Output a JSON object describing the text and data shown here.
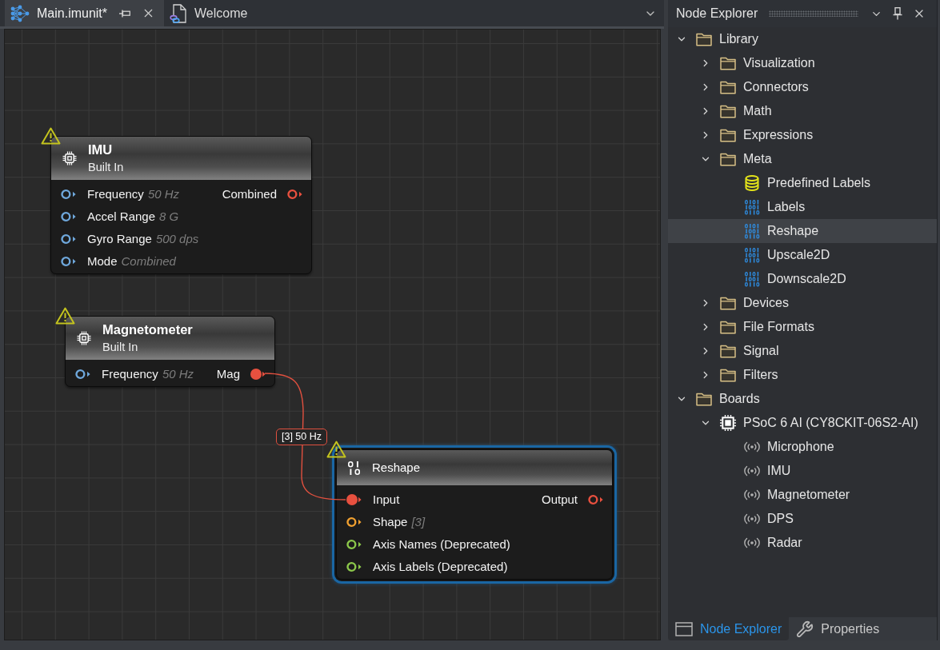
{
  "document_tabs": [
    {
      "label": "Main.imunit*",
      "selected": true
    },
    {
      "label": "Welcome",
      "selected": false
    }
  ],
  "canvas": {
    "nodes": [
      {
        "kind": "device",
        "title": "IMU",
        "subtitle": "Built In",
        "warning": true,
        "selected": false,
        "inputs": [
          {
            "label": "Frequency",
            "value": "50 Hz",
            "color": "#6fa8dc",
            "connected": false
          },
          {
            "label": "Accel Range",
            "value": "8 G",
            "color": "#6fa8dc",
            "connected": false
          },
          {
            "label": "Gyro Range",
            "value": "500 dps",
            "color": "#6fa8dc",
            "connected": false
          },
          {
            "label": "Mode",
            "value": "Combined",
            "color": "#6fa8dc",
            "connected": false
          }
        ],
        "outputs": [
          {
            "label": "Combined",
            "color": "#e8503f",
            "connected": false
          }
        ]
      },
      {
        "kind": "device",
        "title": "Magnetometer",
        "subtitle": "Built In",
        "warning": true,
        "selected": false,
        "inputs": [
          {
            "label": "Frequency",
            "value": "50 Hz",
            "color": "#6fa8dc",
            "connected": false
          }
        ],
        "outputs": [
          {
            "label": "Mag",
            "color": "#e8503f",
            "connected": true
          }
        ]
      },
      {
        "kind": "operation",
        "title": "Reshape",
        "warning": true,
        "selected": true,
        "inputs": [
          {
            "label": "Input",
            "color": "#e8503f",
            "connected": true
          },
          {
            "label": "Shape",
            "value": "[3]",
            "color": "#f0a030",
            "connected": false
          },
          {
            "label": "Axis Names (Deprecated)",
            "color": "#8cc84b",
            "connected": false
          },
          {
            "label": "Axis Labels (Deprecated)",
            "color": "#8cc84b",
            "connected": false
          }
        ],
        "outputs": [
          {
            "label": "Output",
            "color": "#e8503f",
            "connected": false
          }
        ]
      }
    ],
    "connections": [
      {
        "label": "[3] 50 Hz"
      }
    ]
  },
  "panel": {
    "title": "Node Explorer",
    "tree": [
      {
        "label": "Library",
        "kind": "folder",
        "expanded": true,
        "selected": false,
        "children": [
          {
            "label": "Visualization",
            "kind": "folder",
            "expanded": false,
            "selected": false
          },
          {
            "label": "Connectors",
            "kind": "folder",
            "expanded": false,
            "selected": false
          },
          {
            "label": "Math",
            "kind": "folder",
            "expanded": false,
            "selected": false
          },
          {
            "label": "Expressions",
            "kind": "folder",
            "expanded": false,
            "selected": false
          },
          {
            "label": "Meta",
            "kind": "folder",
            "expanded": true,
            "selected": false,
            "children": [
              {
                "label": "Predefined Labels",
                "kind": "database",
                "selected": false
              },
              {
                "label": "Labels",
                "kind": "node",
                "selected": false
              },
              {
                "label": "Reshape",
                "kind": "node",
                "selected": true
              },
              {
                "label": "Upscale2D",
                "kind": "node",
                "selected": false
              },
              {
                "label": "Downscale2D",
                "kind": "node",
                "selected": false
              }
            ]
          },
          {
            "label": "Devices",
            "kind": "folder",
            "expanded": false,
            "selected": false
          },
          {
            "label": "File Formats",
            "kind": "folder",
            "expanded": false,
            "selected": false
          },
          {
            "label": "Signal",
            "kind": "folder",
            "expanded": false,
            "selected": false
          },
          {
            "label": "Filters",
            "kind": "folder",
            "expanded": false,
            "selected": false
          }
        ]
      },
      {
        "label": "Boards",
        "kind": "folder",
        "expanded": true,
        "selected": false,
        "children": [
          {
            "label": "PSoC 6 AI (CY8CKIT-06S2-AI)",
            "kind": "board",
            "expanded": true,
            "selected": false,
            "children": [
              {
                "label": "Microphone",
                "kind": "sensor",
                "selected": false
              },
              {
                "label": "IMU",
                "kind": "sensor",
                "selected": false
              },
              {
                "label": "Magnetometer",
                "kind": "sensor",
                "selected": false
              },
              {
                "label": "DPS",
                "kind": "sensor",
                "selected": false
              },
              {
                "label": "Radar",
                "kind": "sensor",
                "selected": false
              }
            ]
          }
        ]
      }
    ],
    "tabs": [
      {
        "label": "Node Explorer",
        "selected": true
      },
      {
        "label": "Properties",
        "selected": false
      }
    ]
  }
}
